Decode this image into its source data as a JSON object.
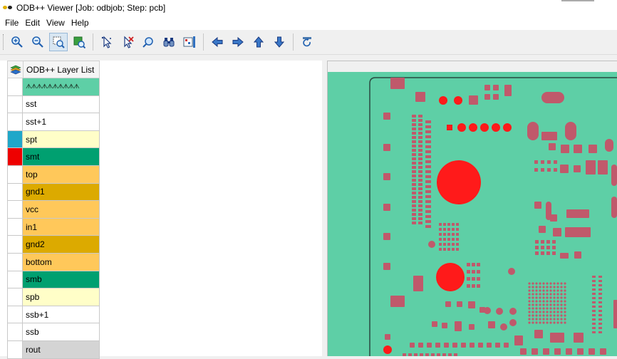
{
  "window": {
    "title": "ODB++ Viewer [Job: odbjob; Step: pcb]"
  },
  "menu": {
    "items": [
      "File",
      "Edit",
      "View",
      "Help"
    ]
  },
  "toolbar": {
    "buttons": [
      {
        "icon": "zoom-in-icon"
      },
      {
        "icon": "zoom-out-icon"
      },
      {
        "icon": "zoom-window-icon",
        "active": true
      },
      {
        "icon": "zoom-fit-icon"
      },
      {
        "icon": "select-arrow-icon"
      },
      {
        "icon": "deselect-icon"
      },
      {
        "icon": "find-icon"
      },
      {
        "icon": "binoculars-icon"
      },
      {
        "icon": "measure-icon"
      },
      {
        "icon": "pan-left-icon"
      },
      {
        "icon": "pan-right-icon"
      },
      {
        "icon": "pan-up-icon"
      },
      {
        "icon": "pan-down-icon"
      },
      {
        "icon": "refresh-icon"
      }
    ]
  },
  "layer_list": {
    "header": "ODB++ Layer List",
    "layers": [
      {
        "name": "ᗑᗑᗑᗑᗑᗑᗑᗑᗑᗑ",
        "color": "#5ecfa6",
        "swatch": "#ffffff",
        "is_art": true
      },
      {
        "name": "sst",
        "color": "#ffffff",
        "swatch": "#ffffff"
      },
      {
        "name": "sst+1",
        "color": "#ffffff",
        "swatch": "#ffffff"
      },
      {
        "name": "spt",
        "color": "#fffec8",
        "swatch": "#1fa7c9"
      },
      {
        "name": "smt",
        "color": "#00a070",
        "swatch": "#ee0000"
      },
      {
        "name": "top",
        "color": "#ffc85a",
        "swatch": "#ffffff"
      },
      {
        "name": "gnd1",
        "color": "#dcaa00",
        "swatch": "#ffffff"
      },
      {
        "name": "vcc",
        "color": "#ffc85a",
        "swatch": "#ffffff"
      },
      {
        "name": "in1",
        "color": "#ffc85a",
        "swatch": "#ffffff"
      },
      {
        "name": "gnd2",
        "color": "#dcaa00",
        "swatch": "#ffffff"
      },
      {
        "name": "bottom",
        "color": "#ffc85a",
        "swatch": "#ffffff"
      },
      {
        "name": "smb",
        "color": "#00a070",
        "swatch": "#ffffff"
      },
      {
        "name": "spb",
        "color": "#fffec8",
        "swatch": "#ffffff"
      },
      {
        "name": "ssb+1",
        "color": "#ffffff",
        "swatch": "#ffffff"
      },
      {
        "name": "ssb",
        "color": "#ffffff",
        "swatch": "#ffffff"
      },
      {
        "name": "rout",
        "color": "#d4d4d4",
        "swatch": "#ffffff"
      }
    ]
  },
  "canvas": {
    "board_color": "#5ecfa6",
    "pad_color": "#c0596b",
    "hole_color": "#ff1a1a",
    "outline_color": "#2a4a40"
  }
}
